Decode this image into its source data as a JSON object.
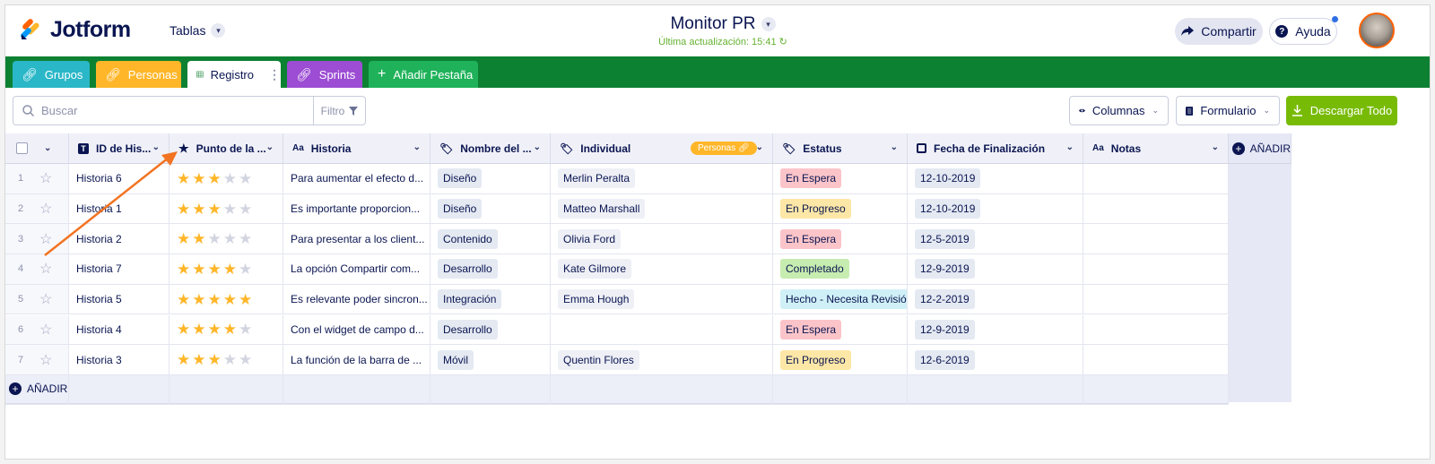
{
  "header": {
    "logo_text": "Jotform",
    "tables_menu": "Tablas",
    "title": "Monitor PR",
    "subtitle": "Última actualización: 15:41",
    "share_label": "Compartir",
    "help_label": "Ayuda"
  },
  "tabs": [
    {
      "label": "Grupos",
      "color": "#2ab7c8",
      "icon": "link-icon"
    },
    {
      "label": "Personas",
      "color": "#ffb629",
      "icon": "link-icon"
    },
    {
      "label": "Registro",
      "color": "#ffffff",
      "icon": "table-icon",
      "active": true
    },
    {
      "label": "Sprints",
      "color": "#9c4dd3",
      "icon": "link-icon"
    },
    {
      "label": "Añadir Pestaña",
      "color": "#1fb25a",
      "icon": "plus-icon"
    }
  ],
  "toolbar": {
    "search_placeholder": "Buscar",
    "filter_label": "Filtro",
    "columns_label": "Columnas",
    "form_label": "Formulario",
    "download_label": "Descargar Todo"
  },
  "columns": [
    {
      "label": "ID de His..."
    },
    {
      "label": "Punto de la ..."
    },
    {
      "label": "Historia"
    },
    {
      "label": "Nombre del ..."
    },
    {
      "label": "Individual",
      "badge": "Personas"
    },
    {
      "label": "Estatus"
    },
    {
      "label": "Fecha de Finalización"
    },
    {
      "label": "Notas"
    }
  ],
  "add_column_label": "AÑADIR",
  "add_row_label": "AÑADIR",
  "rows": [
    {
      "num": "1",
      "id": "Historia 6",
      "rating": 3,
      "historia": "Para aumentar el efecto d...",
      "grupo": "Diseño",
      "individual": "Merlin Peralta",
      "estatus": "En Espera",
      "fecha": "12-10-2019"
    },
    {
      "num": "2",
      "id": "Historia 1",
      "rating": 3,
      "historia": "Es importante proporcion...",
      "grupo": "Diseño",
      "individual": "Matteo Marshall",
      "estatus": "En Progreso",
      "fecha": "12-10-2019"
    },
    {
      "num": "3",
      "id": "Historia 2",
      "rating": 2,
      "historia": "Para presentar a los client...",
      "grupo": "Contenido",
      "individual": "Olivia Ford",
      "estatus": "En Espera",
      "fecha": "12-5-2019"
    },
    {
      "num": "4",
      "id": "Historia 7",
      "rating": 4,
      "historia": "La opción Compartir com...",
      "grupo": "Desarrollo",
      "individual": "Kate Gilmore",
      "estatus": "Completado",
      "fecha": "12-9-2019"
    },
    {
      "num": "5",
      "id": "Historia 5",
      "rating": 5,
      "historia": "Es relevante poder sincron...",
      "grupo": "Integración",
      "individual": "Emma Hough",
      "estatus": "Hecho - Necesita Revisió",
      "fecha": "12-2-2019"
    },
    {
      "num": "6",
      "id": "Historia 4",
      "rating": 4,
      "historia": "Con el widget de campo d...",
      "grupo": "Desarrollo",
      "individual": "",
      "estatus": "En Espera",
      "fecha": "12-9-2019"
    },
    {
      "num": "7",
      "id": "Historia 3",
      "rating": 3,
      "historia": "La función de la barra de ...",
      "grupo": "Móvil",
      "individual": "Quentin Flores",
      "estatus": "En Progreso",
      "fecha": "12-6-2019"
    }
  ],
  "status_colors": {
    "En Espera": "#fbc4c9",
    "En Progreso": "#fde7a6",
    "Completado": "#c7ecb0",
    "Hecho - Necesita Revisió": "#d0f0f7"
  },
  "colors": {
    "tabbar": "#0d8132",
    "download": "#78bb07",
    "star_filled": "#ffb629",
    "star_empty": "#d2d5e0",
    "annotation_arrow": "#f27321"
  }
}
